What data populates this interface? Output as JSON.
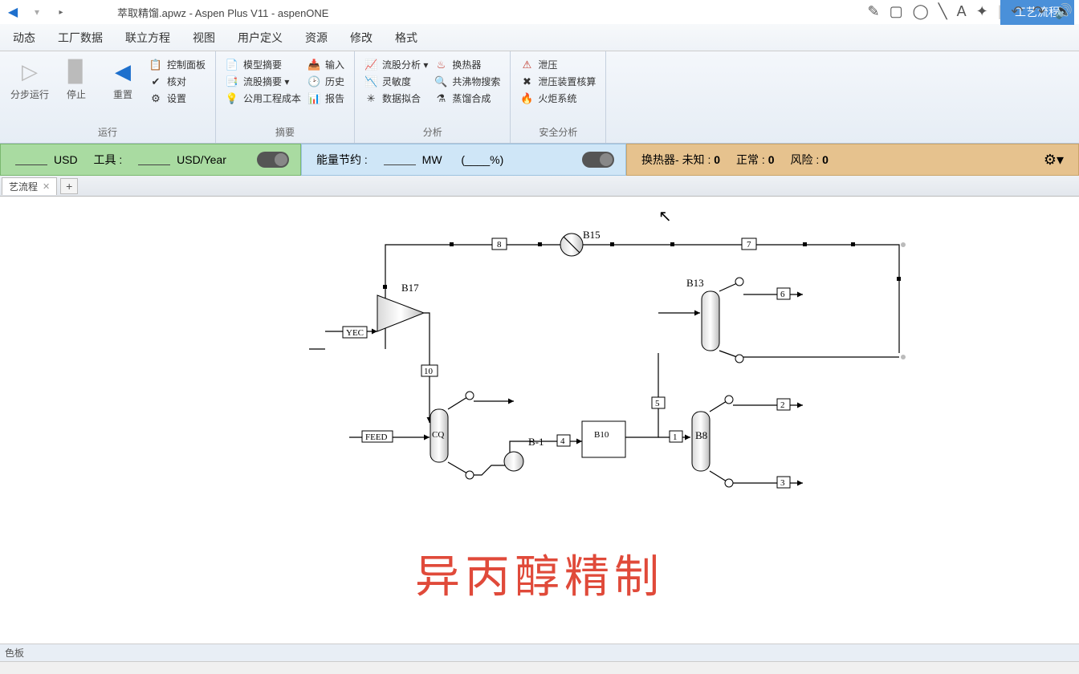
{
  "title": "萃取精馏.apwz - Aspen Plus V11 - aspenONE",
  "contextTab": "工艺流程",
  "menu": [
    "动态",
    "工厂数据",
    "联立方程",
    "视图",
    "用户定义",
    "资源",
    "修改",
    "格式"
  ],
  "ribbon": {
    "run": {
      "label": "运行",
      "step": "分步运行",
      "stop": "停止",
      "reset": "重置",
      "col": [
        "控制面板",
        "核对",
        "设置"
      ]
    },
    "summary": {
      "label": "摘要",
      "col1": [
        "模型摘要",
        "流股摘要 ▾",
        "公用工程成本"
      ],
      "col2": [
        "输入",
        "历史",
        "报告"
      ]
    },
    "analysis": {
      "label": "分析",
      "col1": [
        "流股分析 ▾",
        "灵敏度",
        "数据拟合"
      ],
      "col2": [
        "换热器",
        "共沸物搜索",
        "蒸馏合成"
      ]
    },
    "safety": {
      "label": "安全分析",
      "col": [
        "泄压",
        "泄压装置核算",
        "火炬系统"
      ]
    }
  },
  "strips": {
    "green": {
      "a": "USD",
      "b": "工具 :",
      "c": "USD/Year"
    },
    "blue": {
      "a": "能量节约 :",
      "b": "MW",
      "c": "(____%)"
    },
    "orange": {
      "hx": "换热器-",
      "unk": "未知 :",
      "unkv": "0",
      "ok": "正常 :",
      "okv": "0",
      "risk": "风险 :",
      "riskv": "0"
    }
  },
  "docTab": "艺流程",
  "flow": {
    "streams": {
      "s1": "1",
      "s2": "2",
      "s3": "3",
      "s4": "4",
      "s5": "5",
      "s6": "6",
      "s7": "7",
      "s8": "8",
      "s10": "10"
    },
    "feeds": {
      "yec": "YEC",
      "feed": "FEED"
    },
    "blocks": {
      "b17": "B17",
      "b15": "B15",
      "b13": "B13",
      "b10": "B10",
      "b8": "B8",
      "cq": "CQ",
      "b1": "B-1"
    }
  },
  "caption": "异丙醇精制",
  "palette": "色板"
}
